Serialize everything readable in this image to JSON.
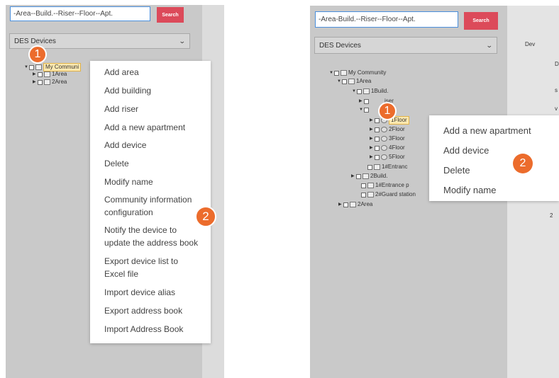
{
  "left_panel": {
    "search_placeholder": "-Area--Build.--Riser--Floor--Apt.",
    "search_button": "Search",
    "device_select": "DES Devices",
    "tree": [
      {
        "label": "My Communi",
        "level": 0
      },
      {
        "label": "1Area",
        "level": 1
      },
      {
        "label": "2Area",
        "level": 1
      }
    ],
    "badge1": "1",
    "badge2": "2",
    "menu": [
      "Add area",
      "Add building",
      "Add riser",
      "Add a new apartment",
      "Add device",
      "Delete",
      "Modify name",
      "Community information",
      "configuration",
      "Notify the device to",
      "update the address book",
      "Export device list to",
      "Excel file",
      "Import device alias",
      "Export address book",
      "Import Address Book"
    ]
  },
  "right_panel": {
    "search_placeholder": "-Area-Build.--Riser--Floor--Apt.",
    "search_button": "Search",
    "device_select": "DES Devices",
    "side_text": [
      "Dev",
      "D",
      "s",
      "v",
      "2"
    ],
    "tree": [
      {
        "label": "My Community"
      },
      {
        "label": "1Area"
      },
      {
        "label": "1Build."
      },
      {
        "label": "iser"
      },
      {
        "label": "iser"
      },
      {
        "label": "1Floor"
      },
      {
        "label": "2Floor"
      },
      {
        "label": "3Floor"
      },
      {
        "label": "4Floor"
      },
      {
        "label": "5Floor"
      },
      {
        "label": "1#Entranc"
      },
      {
        "label": "2Build."
      },
      {
        "label": "1#Entrance p"
      },
      {
        "label": "2#Guard station"
      },
      {
        "label": "2Area"
      }
    ],
    "badge1": "1",
    "badge2": "2",
    "menu": [
      "Add a new apartment",
      "Add device",
      "Delete",
      "Modify name"
    ]
  },
  "colors": {
    "panel_bg": "#c9c9c9",
    "search_button": "#dc4a5a",
    "badge": "#ec6c2c",
    "highlight": "#fde9b0"
  }
}
